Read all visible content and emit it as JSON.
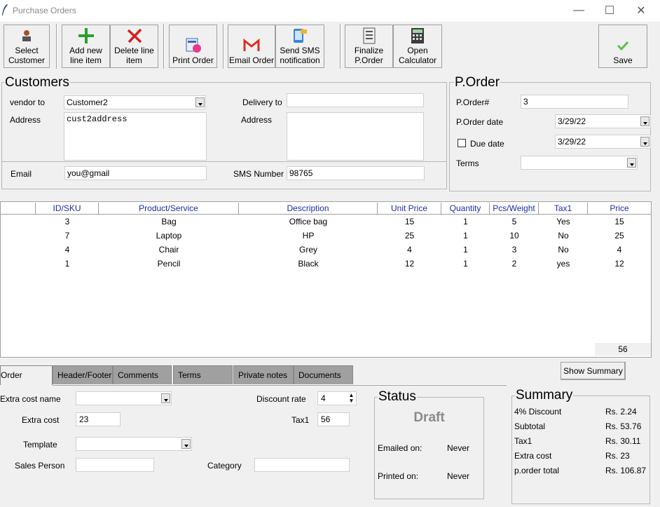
{
  "window": {
    "title": "Purchase Orders",
    "minimize": "—",
    "maximize": "☐",
    "close": "✕"
  },
  "toolbar": {
    "select_customer": "Select Customer",
    "add_line": "Add new line item",
    "delete_line": "Delete line item",
    "print_order": "Print Order",
    "email_order": "Email Order",
    "send_sms": "Send SMS notification",
    "finalize": "Finalize P.Order",
    "calculator": "Open Calculator",
    "save": "Save"
  },
  "customers": {
    "title": "Customers",
    "vendor_to_label": "vendor to",
    "vendor_to_value": "Customer2",
    "address_label": "Address",
    "address_value": "cust2address",
    "delivery_to_label": "Delivery to",
    "delivery_to_value": "",
    "delivery_address_label": "Address",
    "delivery_address_value": "",
    "email_label": "Email",
    "email_value": "you@gmail",
    "sms_label": "SMS Number",
    "sms_value": "98765"
  },
  "porder": {
    "title": "P.Order",
    "number_label": "P.Order#",
    "number_value": "3",
    "date_label": "P.Order date",
    "date_value": "3/29/22",
    "due_label": "Due date",
    "due_value": "3/29/22",
    "due_checked": false,
    "terms_label": "Terms",
    "terms_value": ""
  },
  "table": {
    "columns": [
      "ID/SKU",
      "Product/Service",
      "Description",
      "Unit Price",
      "Quantity",
      "Pcs/Weight",
      "Tax1",
      "Price"
    ],
    "rows": [
      [
        "3",
        "Bag",
        "Office bag",
        "15",
        "1",
        "5",
        "Yes",
        "15"
      ],
      [
        "7",
        "Laptop",
        "HP",
        "25",
        "1",
        "10",
        "No",
        "25"
      ],
      [
        "4",
        "Chair",
        "Grey",
        "4",
        "1",
        "3",
        "No",
        "4"
      ],
      [
        "1",
        "Pencil",
        "Black",
        "12",
        "1",
        "2",
        "yes",
        "12"
      ]
    ],
    "total": "56"
  },
  "tabs": [
    "Order",
    "Header/Footer",
    "Comments",
    "Terms",
    "Private notes",
    "Documents"
  ],
  "show_summary": "Show Summary",
  "order": {
    "extra_cost_name_label": "Extra cost name",
    "extra_cost_name_value": "",
    "extra_cost_label": "Extra cost",
    "extra_cost_value": "23",
    "template_label": "Template",
    "template_value": "",
    "sales_person_label": "Sales Person",
    "sales_person_value": "",
    "discount_label": "Discount rate",
    "discount_value": "4",
    "tax1_label": "Tax1",
    "tax1_value": "56",
    "category_label": "Category",
    "category_value": ""
  },
  "status": {
    "title": "Status",
    "state": "Draft",
    "emailed_label": "Emailed on:",
    "emailed_value": "Never",
    "printed_label": "Printed on:",
    "printed_value": "Never"
  },
  "summary": {
    "title": "Summary",
    "items": [
      {
        "label": "4% Discount",
        "value": "Rs. 2.24"
      },
      {
        "label": "Subtotal",
        "value": "Rs. 53.76"
      },
      {
        "label": "Tax1",
        "value": "Rs. 30.11"
      },
      {
        "label": "Extra cost",
        "value": "Rs. 23"
      },
      {
        "label": "p.order total",
        "value": "Rs. 106.87"
      }
    ]
  },
  "colors": {
    "header_text": "#1c2ea8",
    "add_icon": "#2ca02c",
    "delete_icon": "#d62020",
    "save_check": "#5cbf4a"
  }
}
